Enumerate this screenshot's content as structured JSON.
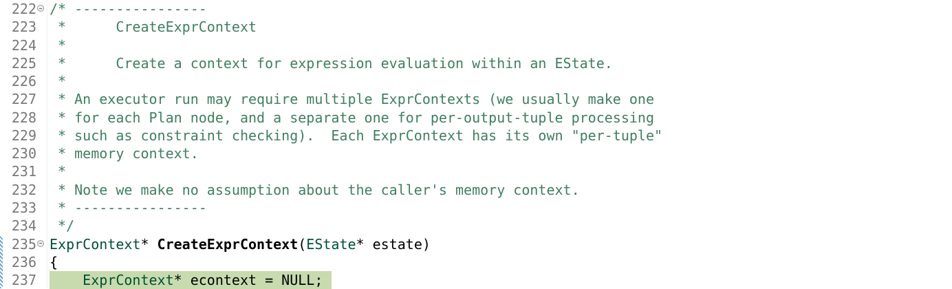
{
  "editor": {
    "lines": [
      {
        "num": "222",
        "fold": true,
        "tokens": [
          {
            "k": "comment",
            "t": "/* ----------------"
          }
        ]
      },
      {
        "num": "223",
        "tokens": [
          {
            "k": "comment",
            "t": " *      CreateExprContext"
          }
        ]
      },
      {
        "num": "224",
        "tokens": [
          {
            "k": "comment",
            "t": " *"
          }
        ]
      },
      {
        "num": "225",
        "tokens": [
          {
            "k": "comment",
            "t": " *      Create a context for expression evaluation within an EState."
          }
        ]
      },
      {
        "num": "226",
        "tokens": [
          {
            "k": "comment",
            "t": " *"
          }
        ]
      },
      {
        "num": "227",
        "tokens": [
          {
            "k": "comment",
            "t": " * An executor run may require multiple ExprContexts (we usually make one"
          }
        ]
      },
      {
        "num": "228",
        "tokens": [
          {
            "k": "comment",
            "t": " * for each Plan node, and a separate one for per-output-tuple processing"
          }
        ]
      },
      {
        "num": "229",
        "tokens": [
          {
            "k": "comment",
            "t": " * such as constraint checking).  Each ExprContext has its own \"per-tuple\""
          }
        ]
      },
      {
        "num": "230",
        "tokens": [
          {
            "k": "comment",
            "t": " * memory context."
          }
        ]
      },
      {
        "num": "231",
        "tokens": [
          {
            "k": "comment",
            "t": " *"
          }
        ]
      },
      {
        "num": "232",
        "tokens": [
          {
            "k": "comment",
            "t": " * Note we make no assumption about the caller's memory context."
          }
        ]
      },
      {
        "num": "233",
        "tokens": [
          {
            "k": "comment",
            "t": " * ----------------"
          }
        ]
      },
      {
        "num": "234",
        "tokens": [
          {
            "k": "comment",
            "t": " */"
          }
        ]
      },
      {
        "num": "235",
        "fold": true,
        "tokens": [
          {
            "k": "type",
            "t": "ExprContext"
          },
          {
            "k": "plain",
            "t": "* "
          },
          {
            "k": "bold",
            "t": "CreateExprContext"
          },
          {
            "k": "plain",
            "t": "("
          },
          {
            "k": "type",
            "t": "EState"
          },
          {
            "k": "plain",
            "t": "* estate)"
          }
        ]
      },
      {
        "num": "236",
        "tokens": [
          {
            "k": "plain",
            "t": "{"
          }
        ]
      },
      {
        "num": "237",
        "highlight": true,
        "tokens": [
          {
            "k": "plain",
            "t": "    "
          },
          {
            "k": "type",
            "t": "ExprContext"
          },
          {
            "k": "plain",
            "t": "* econtext = NULL;"
          }
        ]
      }
    ]
  }
}
